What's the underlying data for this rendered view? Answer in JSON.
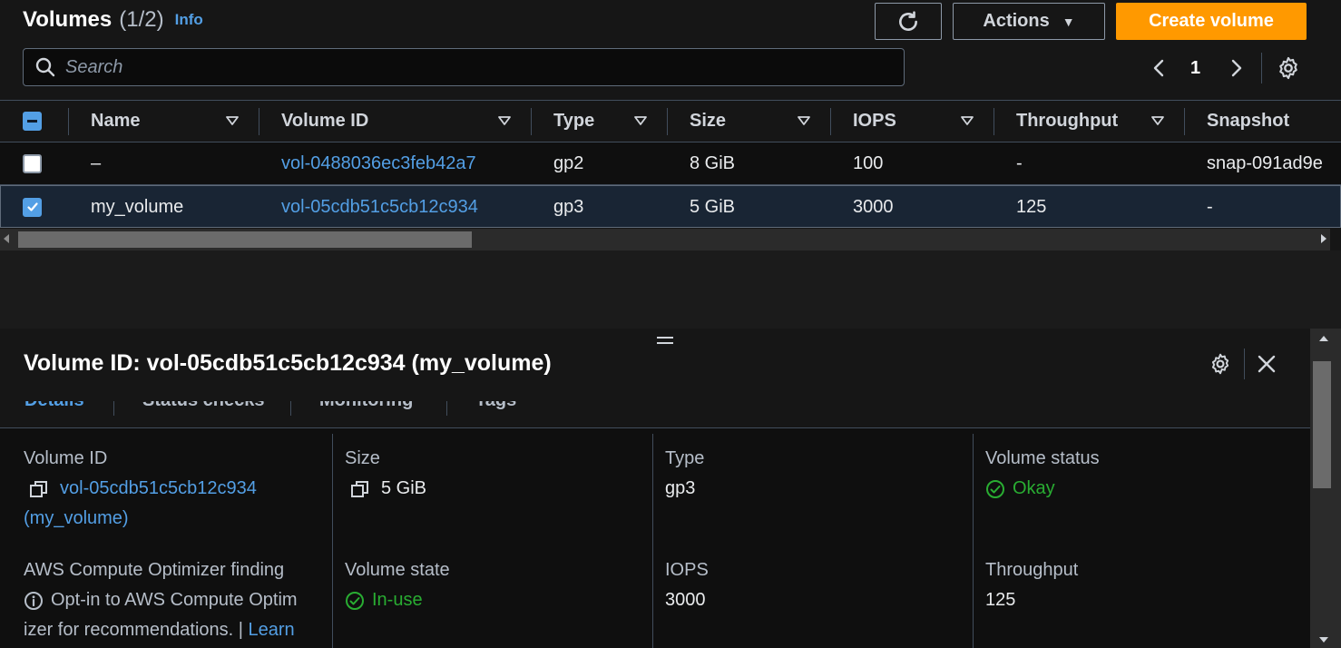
{
  "header": {
    "title": "Volumes",
    "count": "(1/2)",
    "info_label": "Info",
    "actions_label": "Actions",
    "create_label": "Create volume"
  },
  "search": {
    "placeholder": "Search",
    "value": ""
  },
  "pagination": {
    "current_page": "1"
  },
  "table": {
    "columns": [
      "Name",
      "Volume ID",
      "Type",
      "Size",
      "IOPS",
      "Throughput",
      "Snapshot"
    ],
    "rows": [
      {
        "selected": false,
        "name": "–",
        "volume_id": "vol-0488036ec3feb42a7",
        "type": "gp2",
        "size": "8 GiB",
        "iops": "100",
        "throughput": "-",
        "snapshot": "snap-091ad9e"
      },
      {
        "selected": true,
        "name": "my_volume",
        "volume_id": "vol-05cdb51c5cb12c934",
        "type": "gp3",
        "size": "5 GiB",
        "iops": "3000",
        "throughput": "125",
        "snapshot": "-"
      }
    ]
  },
  "detail_panel": {
    "title": "Volume ID: vol-05cdb51c5cb12c934 (my_volume)",
    "tabs": [
      "Details",
      "Status checks",
      "Monitoring",
      "Tags"
    ],
    "fields": {
      "volume_id_label": "Volume ID",
      "volume_id_value": "vol-05cdb51c5cb12c934",
      "volume_id_name": "(my_volume)",
      "size_label": "Size",
      "size_value": "5 GiB",
      "type_label": "Type",
      "type_value": "gp3",
      "status_label": "Volume status",
      "status_value": "Okay",
      "optimizer_label": "AWS Compute Optimizer finding",
      "optimizer_line1": "Opt-in to AWS Compute Optim",
      "optimizer_line2": "izer for recommendations. | ",
      "optimizer_learn": "Learn",
      "state_label": "Volume state",
      "state_value": "In-use",
      "iops_label": "IOPS",
      "iops_value": "3000",
      "throughput_label": "Throughput",
      "throughput_value": "125"
    }
  },
  "colors": {
    "accent": "#539fe5",
    "primary_button": "#ff9900",
    "success": "#29ad32",
    "background": "#161616"
  }
}
